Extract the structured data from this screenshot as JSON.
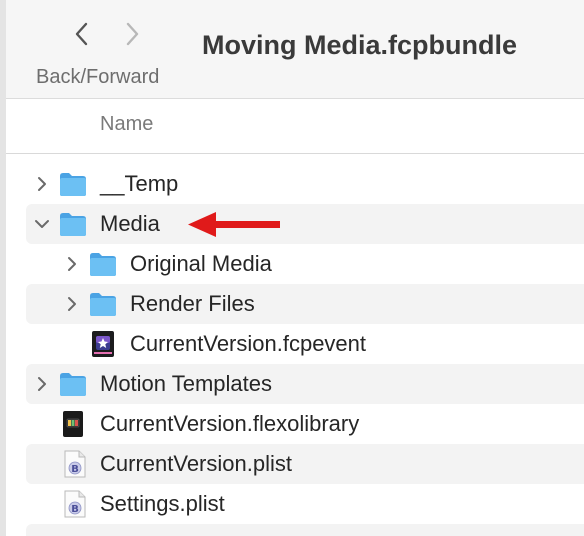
{
  "window": {
    "title": "Moving Media.fcpbundle",
    "nav_label": "Back/Forward"
  },
  "icons": {
    "back": "chevron-left-icon",
    "forward": "chevron-right-icon",
    "folder": "folder-icon",
    "event_file": "fcpevent-file-icon",
    "library_file": "flexolibrary-file-icon",
    "plist_file": "plist-file-icon",
    "annotation": "red-arrow-icon"
  },
  "columns": {
    "name": "Name"
  },
  "colors": {
    "folder": "#5fb6ef",
    "annotation_arrow": "#e01a1a",
    "row_stripe": "#f3f3f3"
  },
  "items": [
    {
      "label": "__Temp",
      "type": "folder",
      "expanded": false
    },
    {
      "label": "Media",
      "type": "folder",
      "expanded": true
    },
    {
      "label": "Original Media",
      "type": "folder",
      "expanded": false
    },
    {
      "label": "Render Files",
      "type": "folder",
      "expanded": false
    },
    {
      "label": "CurrentVersion.fcpevent",
      "type": "fcpevent"
    },
    {
      "label": "Motion Templates",
      "type": "folder",
      "expanded": false
    },
    {
      "label": "CurrentVersion.flexolibrary",
      "type": "flexolibrary"
    },
    {
      "label": "CurrentVersion.plist",
      "type": "plist"
    },
    {
      "label": "Settings.plist",
      "type": "plist"
    }
  ]
}
